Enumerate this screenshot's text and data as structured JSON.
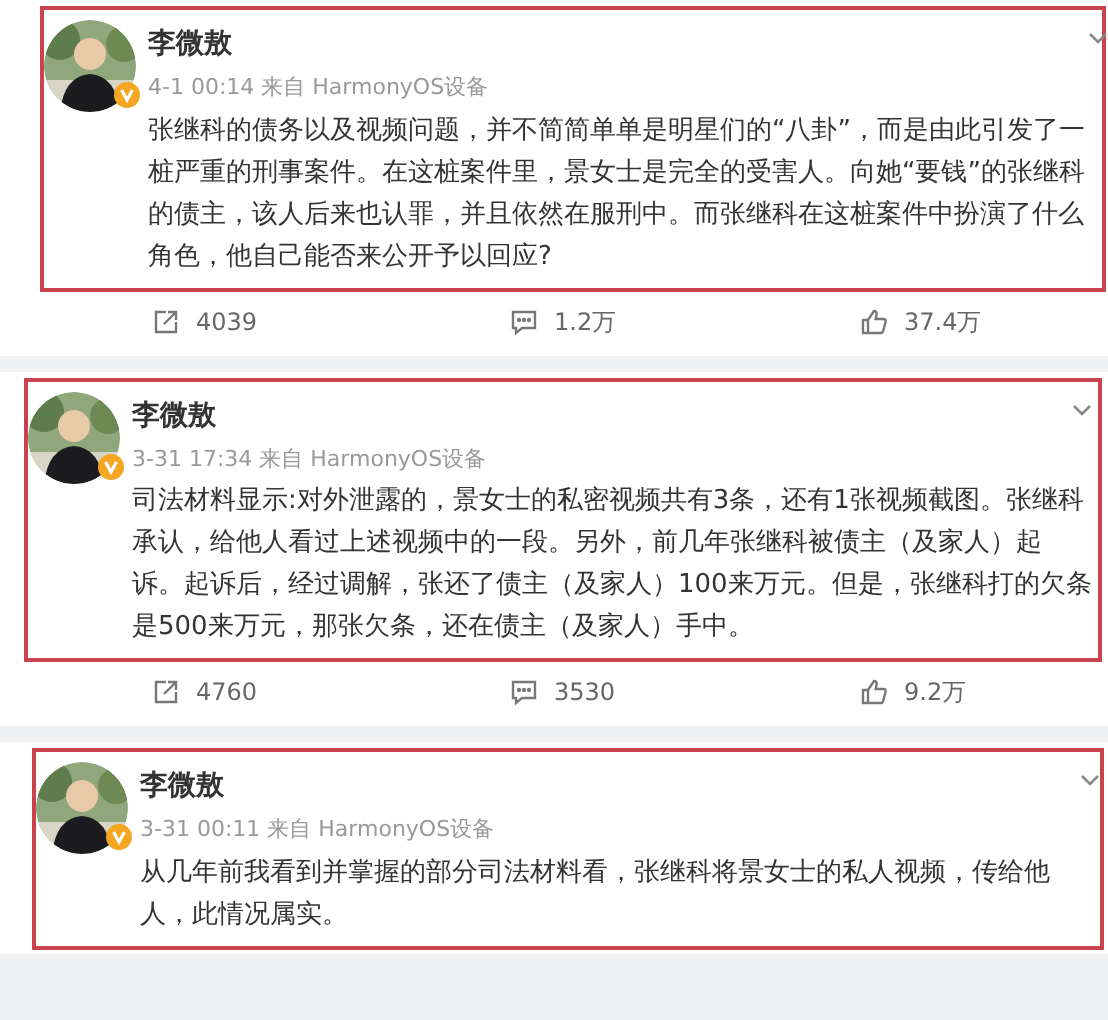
{
  "posts": [
    {
      "author": "李微敖",
      "meta": "4-1 00:14 来自 HarmonyOS设备",
      "text": "张继科的债务以及视频问题，并不简简单单是明星们的“八卦”，而是由此引发了一桩严重的刑事案件。在这桩案件里，景女士是完全的受害人。向她“要钱”的张继科的债主，该人后来也认罪，并且依然在服刑中。而张继科在这桩案件中扮演了什么角色，他自己能否来公开予以回应?",
      "reposts": "4039",
      "comments": "1.2万",
      "likes": "37.4万"
    },
    {
      "author": "李微敖",
      "meta": "3-31 17:34 来自 HarmonyOS设备",
      "text": "司法材料显示:对外泄露的，景女士的私密视频共有3条，还有1张视频截图。张继科承认，给他人看过上述视频中的一段。另外，前几年张继科被债主（及家人）起诉。起诉后，经过调解，张还了债主（及家人）100来万元。但是，张继科打的欠条是500来万元，那张欠条，还在债主（及家人）手中。",
      "reposts": "4760",
      "comments": "3530",
      "likes": "9.2万"
    },
    {
      "author": "李微敖",
      "meta": "3-31 00:11 来自 HarmonyOS设备",
      "text": "从几年前我看到并掌握的部分司法材料看，张继科将景女士的私人视频，传给他人，此情况属实。"
    }
  ]
}
